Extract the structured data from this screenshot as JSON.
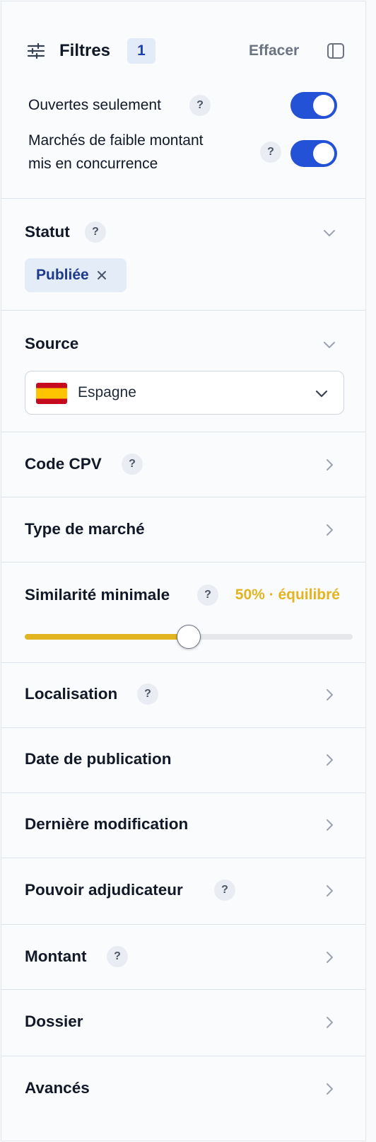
{
  "header": {
    "title": "Filtres",
    "badge": "1",
    "clear_label": "Effacer",
    "filter_icon": "sliders-icon",
    "panel_icon": "sidebar-panel-icon"
  },
  "toggles": [
    {
      "label": "Ouvertes seulement",
      "help": "?",
      "on": true
    },
    {
      "label_line1": "Marchés de faible montant",
      "label_line2": "mis en concurrence",
      "help": "?",
      "on": true
    }
  ],
  "statut": {
    "title": "Statut",
    "help": "?",
    "chip_label": "Publiée",
    "chip_remove_icon": "close-icon"
  },
  "source": {
    "title": "Source",
    "selected": "Espagne",
    "flag_icon": "spain-flag-icon"
  },
  "sections": {
    "cpv": {
      "title": "Code CPV",
      "help": "?"
    },
    "type_marche": {
      "title": "Type de marché"
    },
    "similarite": {
      "title": "Similarité minimale",
      "help": "?",
      "value_label": "50% · équilibré",
      "value_fraction": 0.5
    },
    "localisation": {
      "title": "Localisation",
      "help": "?"
    },
    "date_publication": {
      "title": "Date de publication"
    },
    "derniere_modification": {
      "title": "Dernière modification"
    },
    "pouvoir_adjudicateur": {
      "title": "Pouvoir adjudicateur",
      "help": "?"
    },
    "montant": {
      "title": "Montant",
      "help": "?"
    },
    "dossier": {
      "title": "Dossier"
    },
    "avances": {
      "title": "Avancés"
    }
  },
  "colors": {
    "accent": "#2452d6",
    "similarity": "#e3b421",
    "chip_bg": "#e4ecf8",
    "chip_text": "#1e3a8a"
  }
}
